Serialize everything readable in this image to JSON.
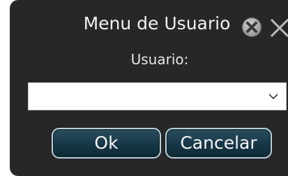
{
  "dialog": {
    "title": "Menu de Usuario",
    "close_icon": "close-circle-icon",
    "close_x_icon": "close-x-icon",
    "user_label": "Usuario:",
    "user_select": {
      "value": "",
      "chevron_icon": "chevron-down-icon"
    },
    "buttons": {
      "ok_label": "Ok",
      "cancel_label": "Cancelar"
    }
  },
  "colors": {
    "dialog_bg": "#272727",
    "button_bg": "#173747",
    "button_border": "#b9d3dc",
    "text": "#f2f2f2"
  }
}
